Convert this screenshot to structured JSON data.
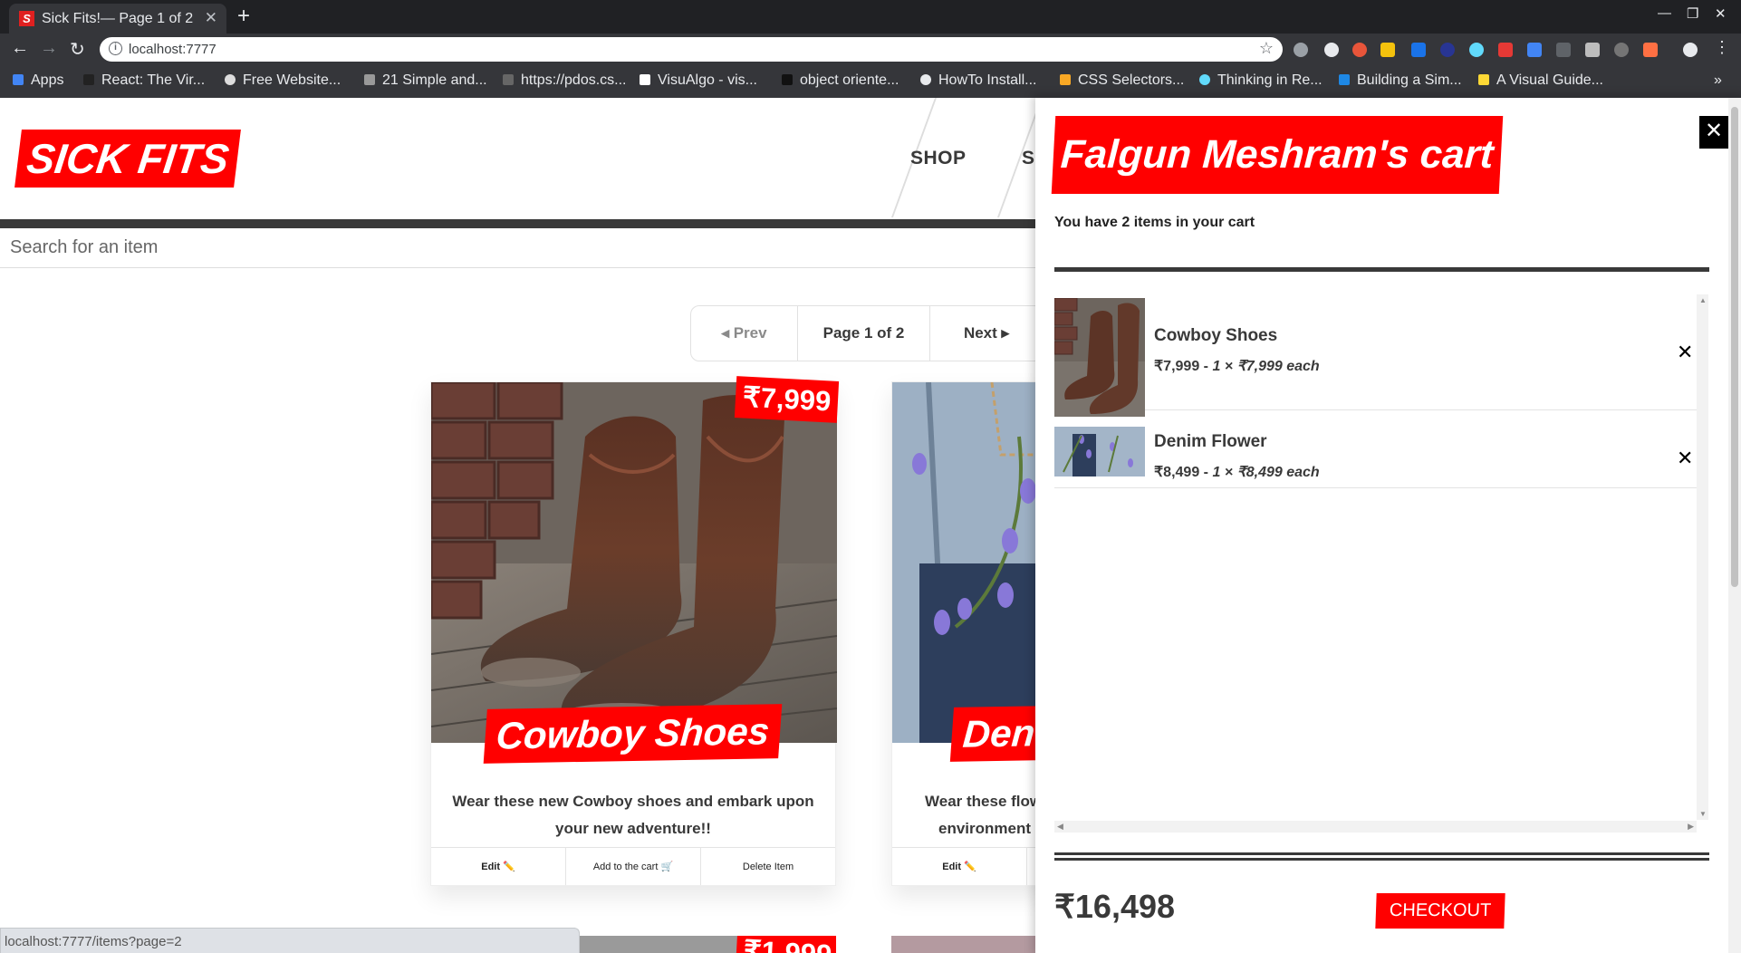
{
  "browser": {
    "tab_title": "Sick Fits!— Page 1 of 2",
    "favicon_letter": "S",
    "url": "localhost:7777",
    "bookmarks": [
      "Apps",
      "React: The Vir...",
      "Free Website...",
      "21 Simple and...",
      "https://pdos.cs...",
      "VisuAlgo - vis...",
      "object oriente...",
      "HowTo Install...",
      "CSS Selectors...",
      "Thinking in Re...",
      "Building a Sim...",
      "A Visual Guide..."
    ],
    "status_url": "localhost:7777/items?page=2"
  },
  "header": {
    "logo": "SICK FITS",
    "nav": [
      "SHOP",
      "S"
    ]
  },
  "search": {
    "placeholder": "Search for an item"
  },
  "pagination": {
    "prev": "◂ Prev",
    "info": "Page 1 of 2",
    "next": "Next ▸"
  },
  "items": [
    {
      "title": "Cowboy Shoes",
      "price": "₹7,999",
      "description": "Wear these new Cowboy shoes and embark upon your new adventure!!",
      "edit": "Edit ✏️",
      "add": "Add to the cart 🛒",
      "delete": "Delete Item"
    },
    {
      "title": "Den",
      "price": "",
      "description": "Wear these flow... environment c...",
      "desc_line1": "Wear these flow",
      "desc_line2": "environment c",
      "edit": "Edit ✏️",
      "add": "",
      "delete": ""
    }
  ],
  "next_row_price": "₹1,999",
  "cart": {
    "title": "Falgun Meshram's cart",
    "subtitle": "You have 2 items in your cart",
    "items": [
      {
        "name": "Cowboy Shoes",
        "total": "₹7,999",
        "sep": " - ",
        "qty": "1 × ₹7,999 each"
      },
      {
        "name": "Denim Flower",
        "total": "₹8,499",
        "sep": " - ",
        "qty": "1 × ₹8,499 each"
      }
    ],
    "total": "₹16,498",
    "checkout": "CHECKOUT",
    "close": "✕",
    "remove": "✕"
  },
  "colors": {
    "brand_red": "#ff0000",
    "dark": "#393939"
  }
}
